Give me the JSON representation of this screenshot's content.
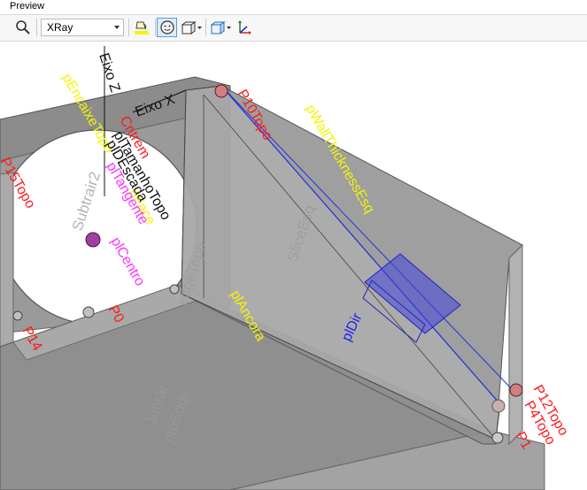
{
  "window": {
    "title": "Preview"
  },
  "toolbar": {
    "search_icon": "magnifier-icon",
    "display_mode": "XRay",
    "icons": [
      "paint-bucket-icon",
      "face-select-icon",
      "box-view-icon",
      "cube-dropdown-icon",
      "axis-icon"
    ]
  },
  "colors": {
    "point_label": "#ff1a1a",
    "param_label": "#f5f500",
    "tangent_label": "#ff33ff",
    "plane_label": "#2222ee",
    "ghost_label": "#9a9a9a"
  },
  "labels": {
    "p10topo": "P10Topo",
    "p15topo": "P15Topo",
    "p0": "P0",
    "p14": "P14",
    "p12topo": "P12Topo",
    "p4topo": "P4Topo",
    "p1": "P1",
    "pwall": "pWallThicknessEsq",
    "penc": "pEncaixeTopo",
    "pancora": "plAncora",
    "pcentro": "plCentro",
    "ptamanho": "plTamanhoTopo",
    "pcantam": "Cntrem",
    "ptangente": "plTangente",
    "pescada": "plDEscada",
    "pfac": "pFace",
    "pdir": "plDir",
    "eixox": "Eixo X",
    "eixoz": "Eixo Z",
    "subtrair": "Subtrair2",
    "slice": "SliceEsq",
    "juntar": "Juntar",
    "edgetopo": "edgeTopo",
    "ptoedge": "ptoEdge"
  }
}
